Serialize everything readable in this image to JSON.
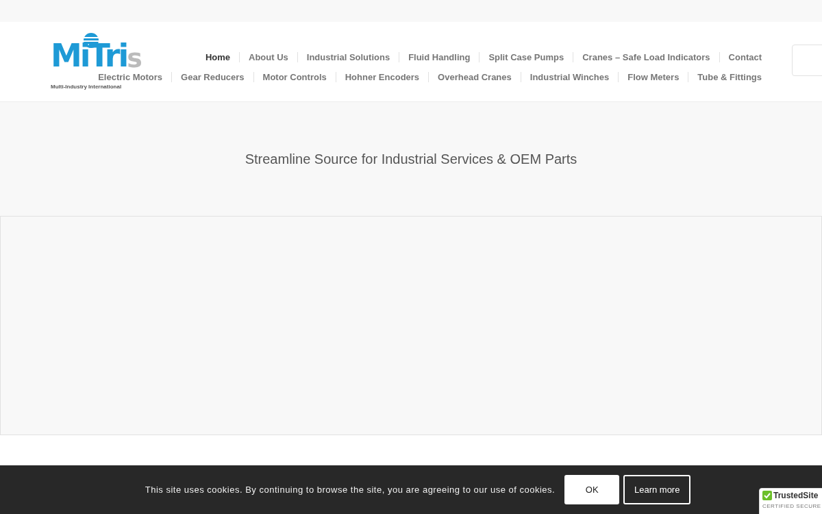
{
  "logo": {
    "main": "MiTri",
    "accent": "s",
    "tagline": "Multi-Industry International"
  },
  "nav": {
    "main": [
      {
        "label": "Home",
        "selected": true
      },
      {
        "label": "About Us",
        "selected": false
      },
      {
        "label": "Industrial Solutions",
        "selected": false
      },
      {
        "label": "Fluid Handling",
        "selected": false
      },
      {
        "label": "Split Case Pumps",
        "selected": false
      },
      {
        "label": "Cranes – Safe Load Indicators",
        "selected": false
      },
      {
        "label": "Contact",
        "selected": false
      }
    ],
    "products": [
      {
        "label": "Electric Motors",
        "selected": false
      },
      {
        "label": "Gear Reducers",
        "selected": false
      },
      {
        "label": "Motor Controls",
        "selected": false
      },
      {
        "label": "Hohner Encoders",
        "selected": false
      },
      {
        "label": "Overhead Cranes",
        "selected": false
      },
      {
        "label": "Industrial Winches",
        "selected": false
      },
      {
        "label": "Flow Meters",
        "selected": false
      },
      {
        "label": "Tube & Fittings",
        "selected": false
      }
    ]
  },
  "hero": {
    "title": "Streamline Source for Industrial Services & OEM Parts"
  },
  "cookie_bar": {
    "message": "This site uses cookies. By continuing to browse the site, you are agreeing to our use of cookies.",
    "buttons": [
      {
        "label": "OK",
        "kind": "primary"
      },
      {
        "label": "Learn more",
        "kind": "outline"
      }
    ]
  },
  "trust_badge": {
    "name": "TrustedSite",
    "caption": "CERTIFIED SECURE"
  }
}
